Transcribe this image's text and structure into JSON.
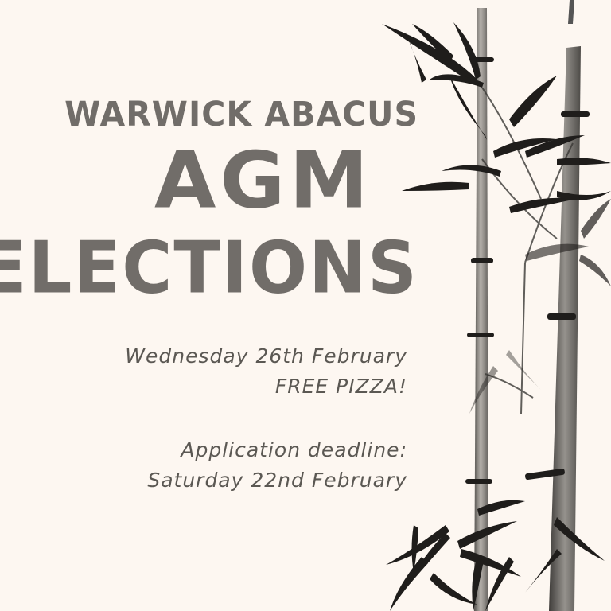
{
  "poster": {
    "organisation": "WARWICK ABACUS",
    "headline_1": "AGM",
    "headline_2": "ELECTIONS",
    "event_date": "Wednesday 26th February",
    "perk": "FREE PIZZA!",
    "deadline_label": "Application deadline:",
    "deadline_date": "Saturday 22nd February"
  },
  "colors": {
    "background": "#fdf7f1",
    "heading": "#716d69",
    "body_text": "#5b5853",
    "ink": "#1f1d1b"
  },
  "decoration": {
    "illustration": "ink-bamboo-painting"
  }
}
